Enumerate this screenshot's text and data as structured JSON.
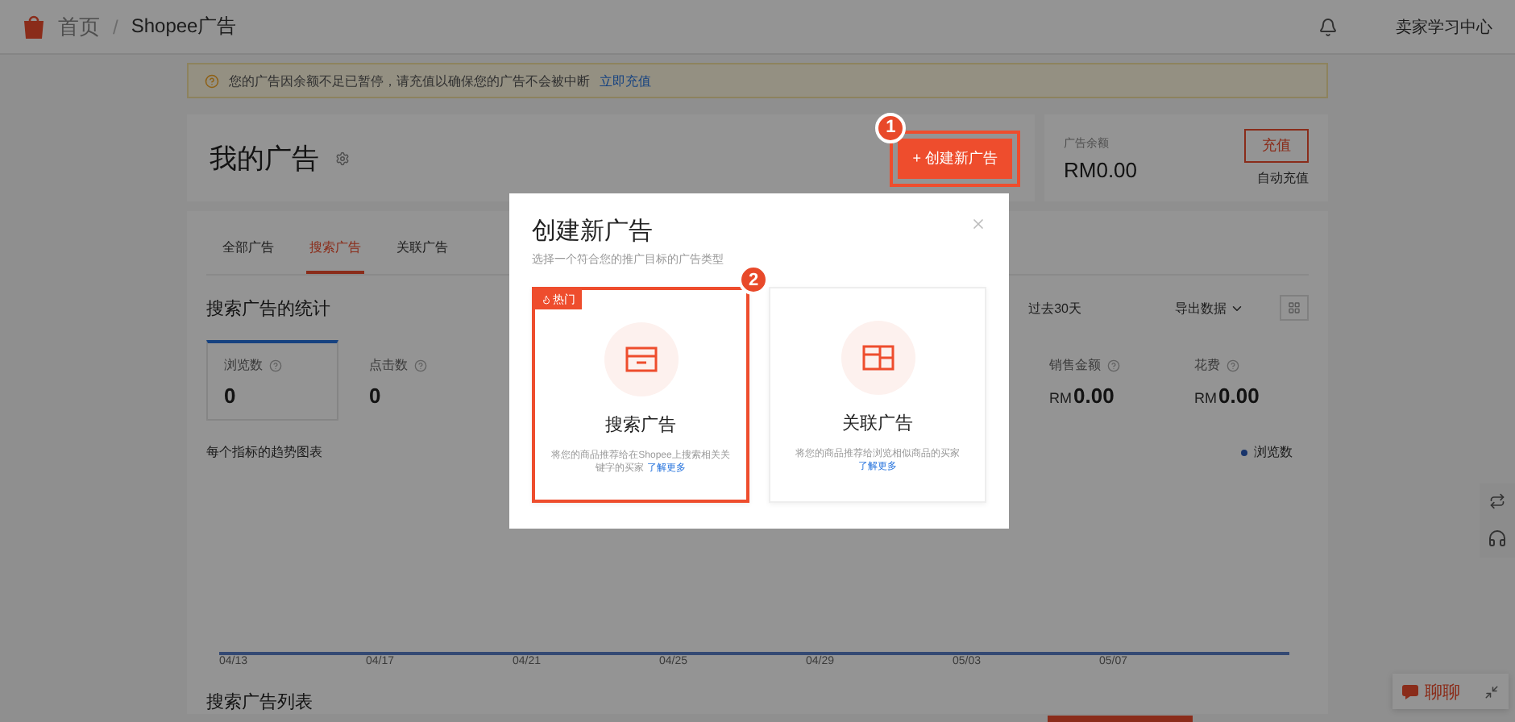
{
  "header": {
    "breadcrumb": [
      "首页",
      "Shopee广告"
    ],
    "separator": "/",
    "account": "卖家学习中心"
  },
  "notice": {
    "text": "您的广告因余额不足已暂停，请充值以确保您的广告不会被中断",
    "link": "立即充值"
  },
  "my_ads": {
    "title": "我的广告",
    "create_button": {
      "label": "+ 创建新广告",
      "annotation": "1"
    }
  },
  "balance": {
    "label": "广告余额",
    "amount": "RM0.00",
    "top_up": "充值",
    "auto_top_up": "自动充值"
  },
  "tabs": [
    {
      "label": "全部广告",
      "selected": false
    },
    {
      "label": "搜索广告",
      "selected": true
    },
    {
      "label": "关联广告",
      "selected": false
    }
  ],
  "stats": {
    "title": "搜索广告的统计",
    "period": "过去30天",
    "export": "导出数据",
    "metrics_left": [
      {
        "label": "浏览数",
        "value": "0",
        "selected": true
      },
      {
        "label": "点击数",
        "value": "0",
        "selected": false
      }
    ],
    "metrics_right": [
      {
        "label": "销售金额",
        "currency": "RM",
        "value": "0.00",
        "selected": false
      },
      {
        "label": "花费",
        "currency": "RM",
        "value": "0.00",
        "selected": false
      }
    ],
    "chart_title": "每个指标的趋势图表",
    "legend": "浏览数",
    "x_labels": [
      "04/13",
      "04/17",
      "04/21",
      "04/25",
      "04/29",
      "05/03",
      "05/07"
    ]
  },
  "list_title": "搜索广告列表",
  "chat": {
    "label": "聊聊"
  },
  "modal": {
    "title": "创建新广告",
    "subtitle": "选择一个符合您的推广目标的广告类型",
    "options": [
      {
        "kind": "search",
        "title": "搜索广告",
        "badge": "热门",
        "description": "将您的商品推荐给在Shopee上搜索相关关键字的买家",
        "link": "了解更多",
        "selected": true,
        "annotation": "2"
      },
      {
        "kind": "discovery",
        "title": "关联广告",
        "description": "将您的商品推荐给浏览相似商品的买家",
        "link": "了解更多",
        "selected": false
      }
    ]
  }
}
